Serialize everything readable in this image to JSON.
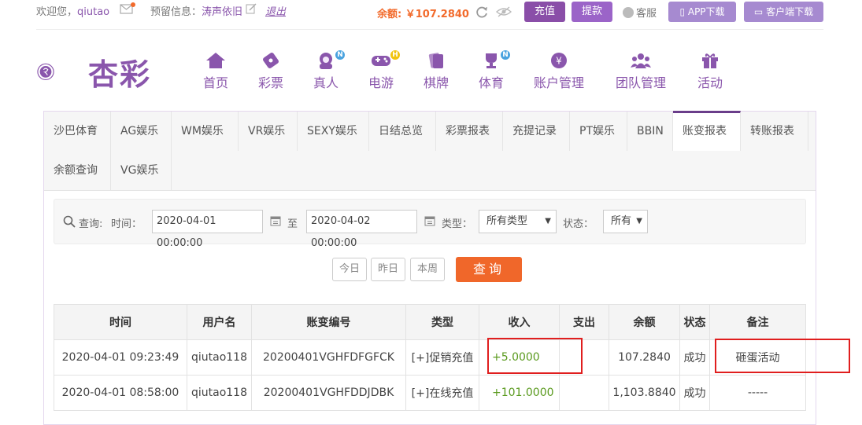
{
  "topbar": {
    "welcome_prefix": "欢迎您，",
    "username": "qiutao",
    "reserved_label": "预留信息：",
    "reserved_value": "涛声依旧",
    "logout": "退出",
    "balance": "余额: ￥107.2840",
    "charge": "充值",
    "withdraw": "提款",
    "service": "客服",
    "app_download": "APP下载",
    "client_download": "客户端下载"
  },
  "logo": {
    "text": "杏彩"
  },
  "nav": [
    {
      "label": "首页",
      "icon": "home-icon"
    },
    {
      "label": "彩票",
      "icon": "lottery-icon"
    },
    {
      "label": "真人",
      "icon": "live-dealer-icon",
      "badge": "N"
    },
    {
      "label": "电游",
      "icon": "gamepad-icon",
      "badge": "H"
    },
    {
      "label": "棋牌",
      "icon": "cards-icon"
    },
    {
      "label": "体育",
      "icon": "trophy-icon",
      "badge": "N"
    },
    {
      "label": "账户管理",
      "icon": "yen-coin-icon"
    },
    {
      "label": "团队管理",
      "icon": "team-icon"
    },
    {
      "label": "活动",
      "icon": "gift-icon"
    }
  ],
  "tabs": [
    "沙巴体育",
    "AG娱乐",
    "WM娱乐",
    "VR娱乐",
    "SEXY娱乐",
    "日结总览",
    "彩票报表",
    "充提记录",
    "PT娱乐",
    "BBIN",
    "账变报表",
    "转账报表",
    "余额查询",
    "VG娱乐"
  ],
  "active_tab": "账变报表",
  "query": {
    "label": "查询:",
    "time_label": "时间：",
    "start": "2020-04-01 00:00:00",
    "to": "至",
    "end": "2020-04-02 00:00:00",
    "type_label": "类型：",
    "type_value": "所有类型",
    "status_label": "状态：",
    "status_value": "所有",
    "quick": [
      "今日",
      "昨日",
      "本周"
    ],
    "submit": "查询"
  },
  "table": {
    "headers": [
      "时间",
      "用户名",
      "账变编号",
      "类型",
      "收入",
      "支出",
      "余额",
      "状态",
      "备注"
    ],
    "rows": [
      [
        "2020-04-01 09:23:49",
        "qiutao118",
        "20200401VGHFDFGFCK",
        "[+]促销充值",
        "+5.0000",
        "",
        "107.2840",
        "成功",
        "砸蛋活动"
      ],
      [
        "2020-04-01 08:58:00",
        "qiutao118",
        "20200401VGHFDDJDBK",
        "[+]在线充值",
        "+101.0000",
        "",
        "1,103.8840",
        "成功",
        "-----"
      ]
    ]
  },
  "colors": {
    "brand_purple": "#8a56ac",
    "balance_orange": "#f26a2b",
    "query_button": "#f0672a",
    "income_green": "#5a9a1e",
    "highlight_red": "#e01e1e"
  }
}
